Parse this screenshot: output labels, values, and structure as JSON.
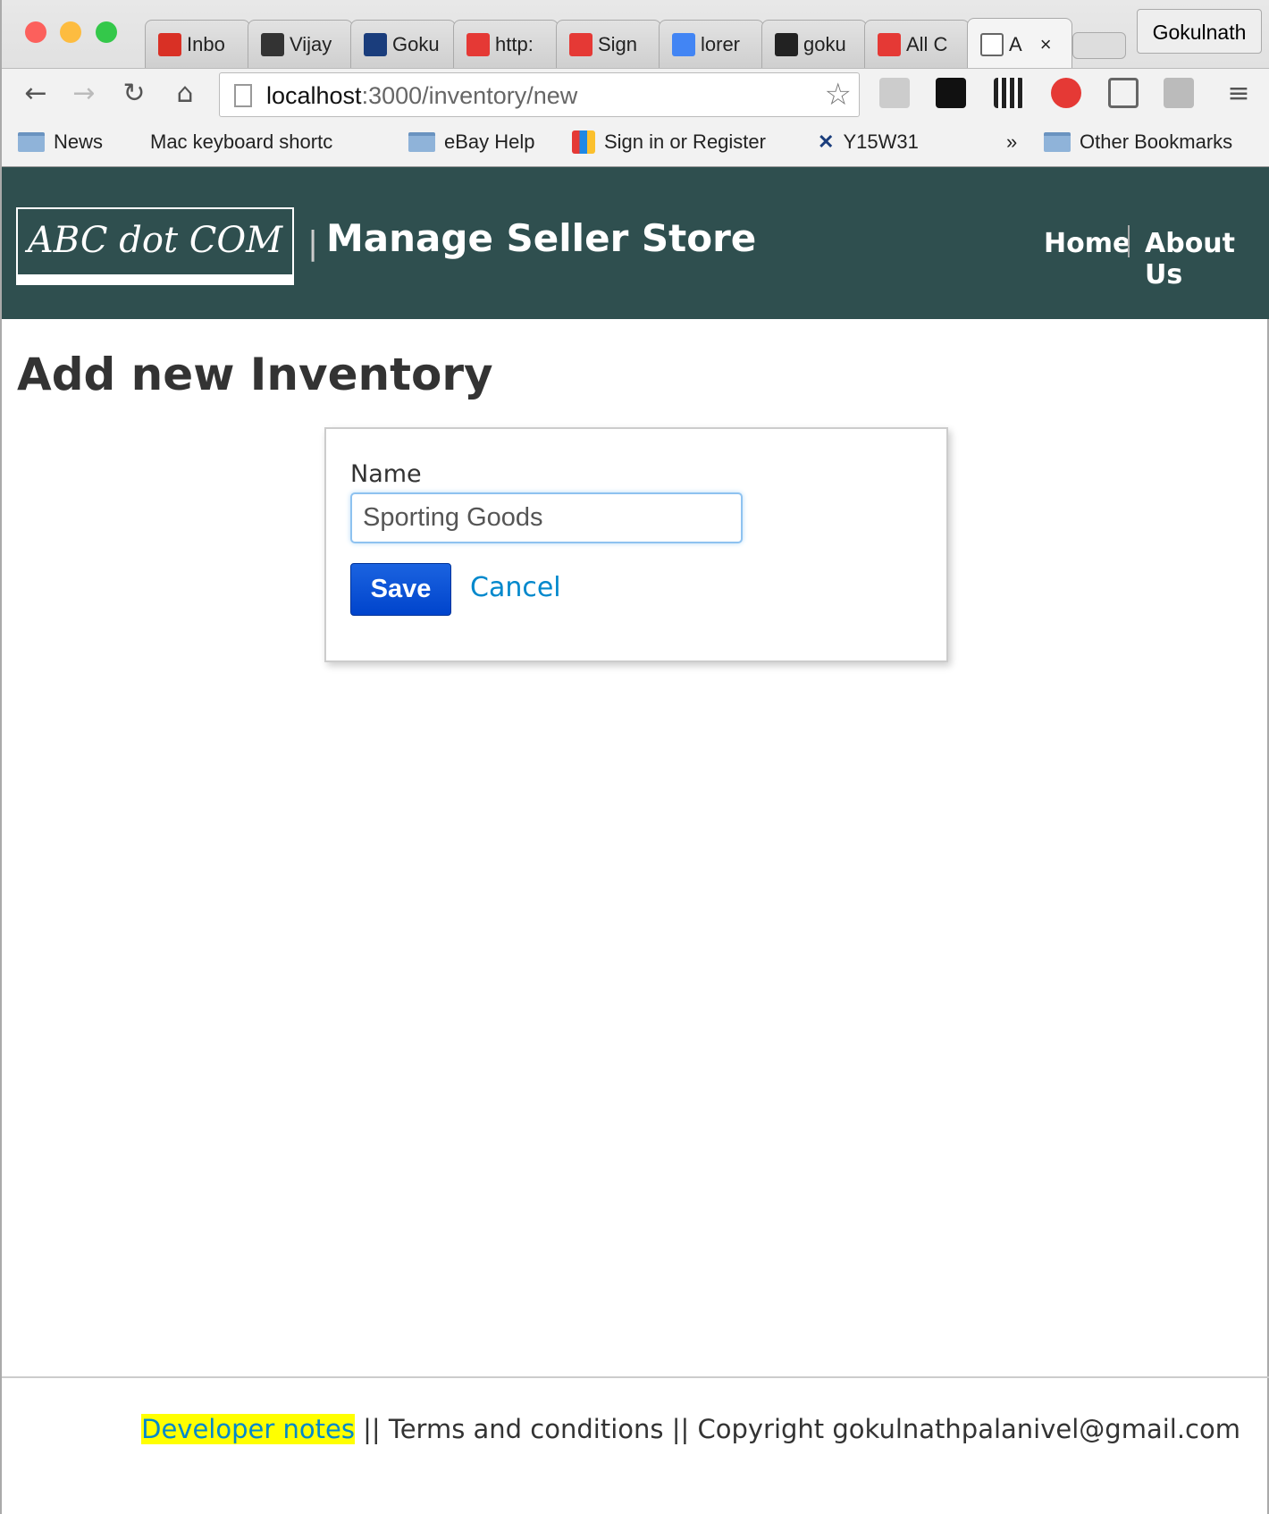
{
  "browser": {
    "tabs": [
      {
        "label": "Inbo",
        "color": "#d93025"
      },
      {
        "label": "Vijay",
        "color": "#333333"
      },
      {
        "label": "Goku",
        "color": "#1a3d7c"
      },
      {
        "label": "http:",
        "color": "#e53935"
      },
      {
        "label": "Sign",
        "color": "#e53935"
      },
      {
        "label": "lorer",
        "color": "#4285f4"
      },
      {
        "label": "goku",
        "color": "#222222"
      },
      {
        "label": "All C",
        "color": "#e53935"
      },
      {
        "label": "A",
        "color": "#ffffff"
      }
    ],
    "profile": "Gokulnath",
    "url_host": "localhost",
    "url_rest": ":3000/inventory/new",
    "bookmarks": [
      "News",
      "Mac keyboard shortc",
      "eBay Help",
      "Sign in or Register",
      "Y15W31"
    ],
    "overflow": "»",
    "other_bookmarks": "Other Bookmarks"
  },
  "header": {
    "logo": "ABC dot COM",
    "separator": "|",
    "title": "Manage Seller Store",
    "nav": [
      "Home",
      "About Us"
    ],
    "color": "#2f4f4f"
  },
  "page": {
    "heading": "Add new Inventory"
  },
  "form": {
    "name_label": "Name",
    "name_value": "Sporting Goods",
    "save_label": "Save",
    "cancel_label": "Cancel"
  },
  "footer": {
    "dev_notes": "Developer notes",
    "rest": " || Terms and conditions || Copyright gokulnathpalanivel@gmail.com"
  }
}
